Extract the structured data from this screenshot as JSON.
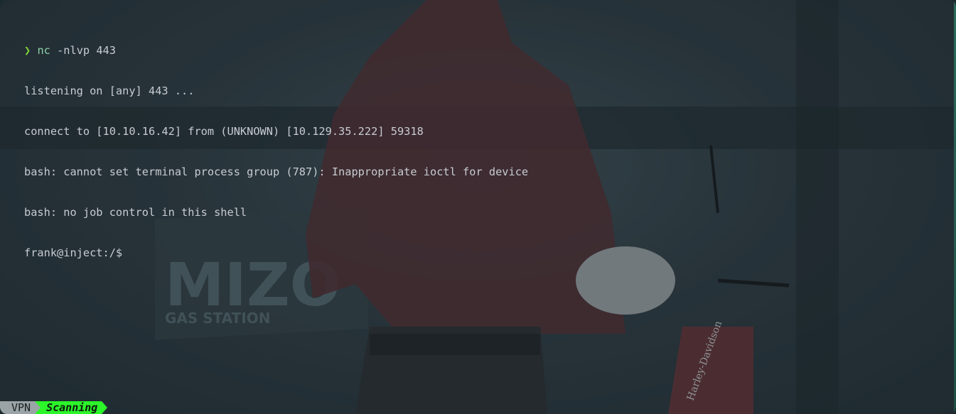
{
  "terminal": {
    "prompt_symbol": "❯",
    "command_name": "nc",
    "command_args": " -nlvp 443",
    "output": [
      "listening on [any] 443 ...",
      "connect to [10.10.16.42] from (UNKNOWN) [10.129.35.222] 59318",
      "bash: cannot set terminal process group (787): Inappropriate ioctl for device",
      "bash: no job control in this shell",
      "frank@inject:/$"
    ]
  },
  "wallpaper": {
    "sign_text": "MIZO",
    "sign_subtext": "GAS STATION",
    "bike_brand": "Harley-Davidson"
  },
  "statusbar": {
    "vpn_label": "VPN",
    "status_label": "Scanning",
    "status_color": "#2cf52a"
  }
}
